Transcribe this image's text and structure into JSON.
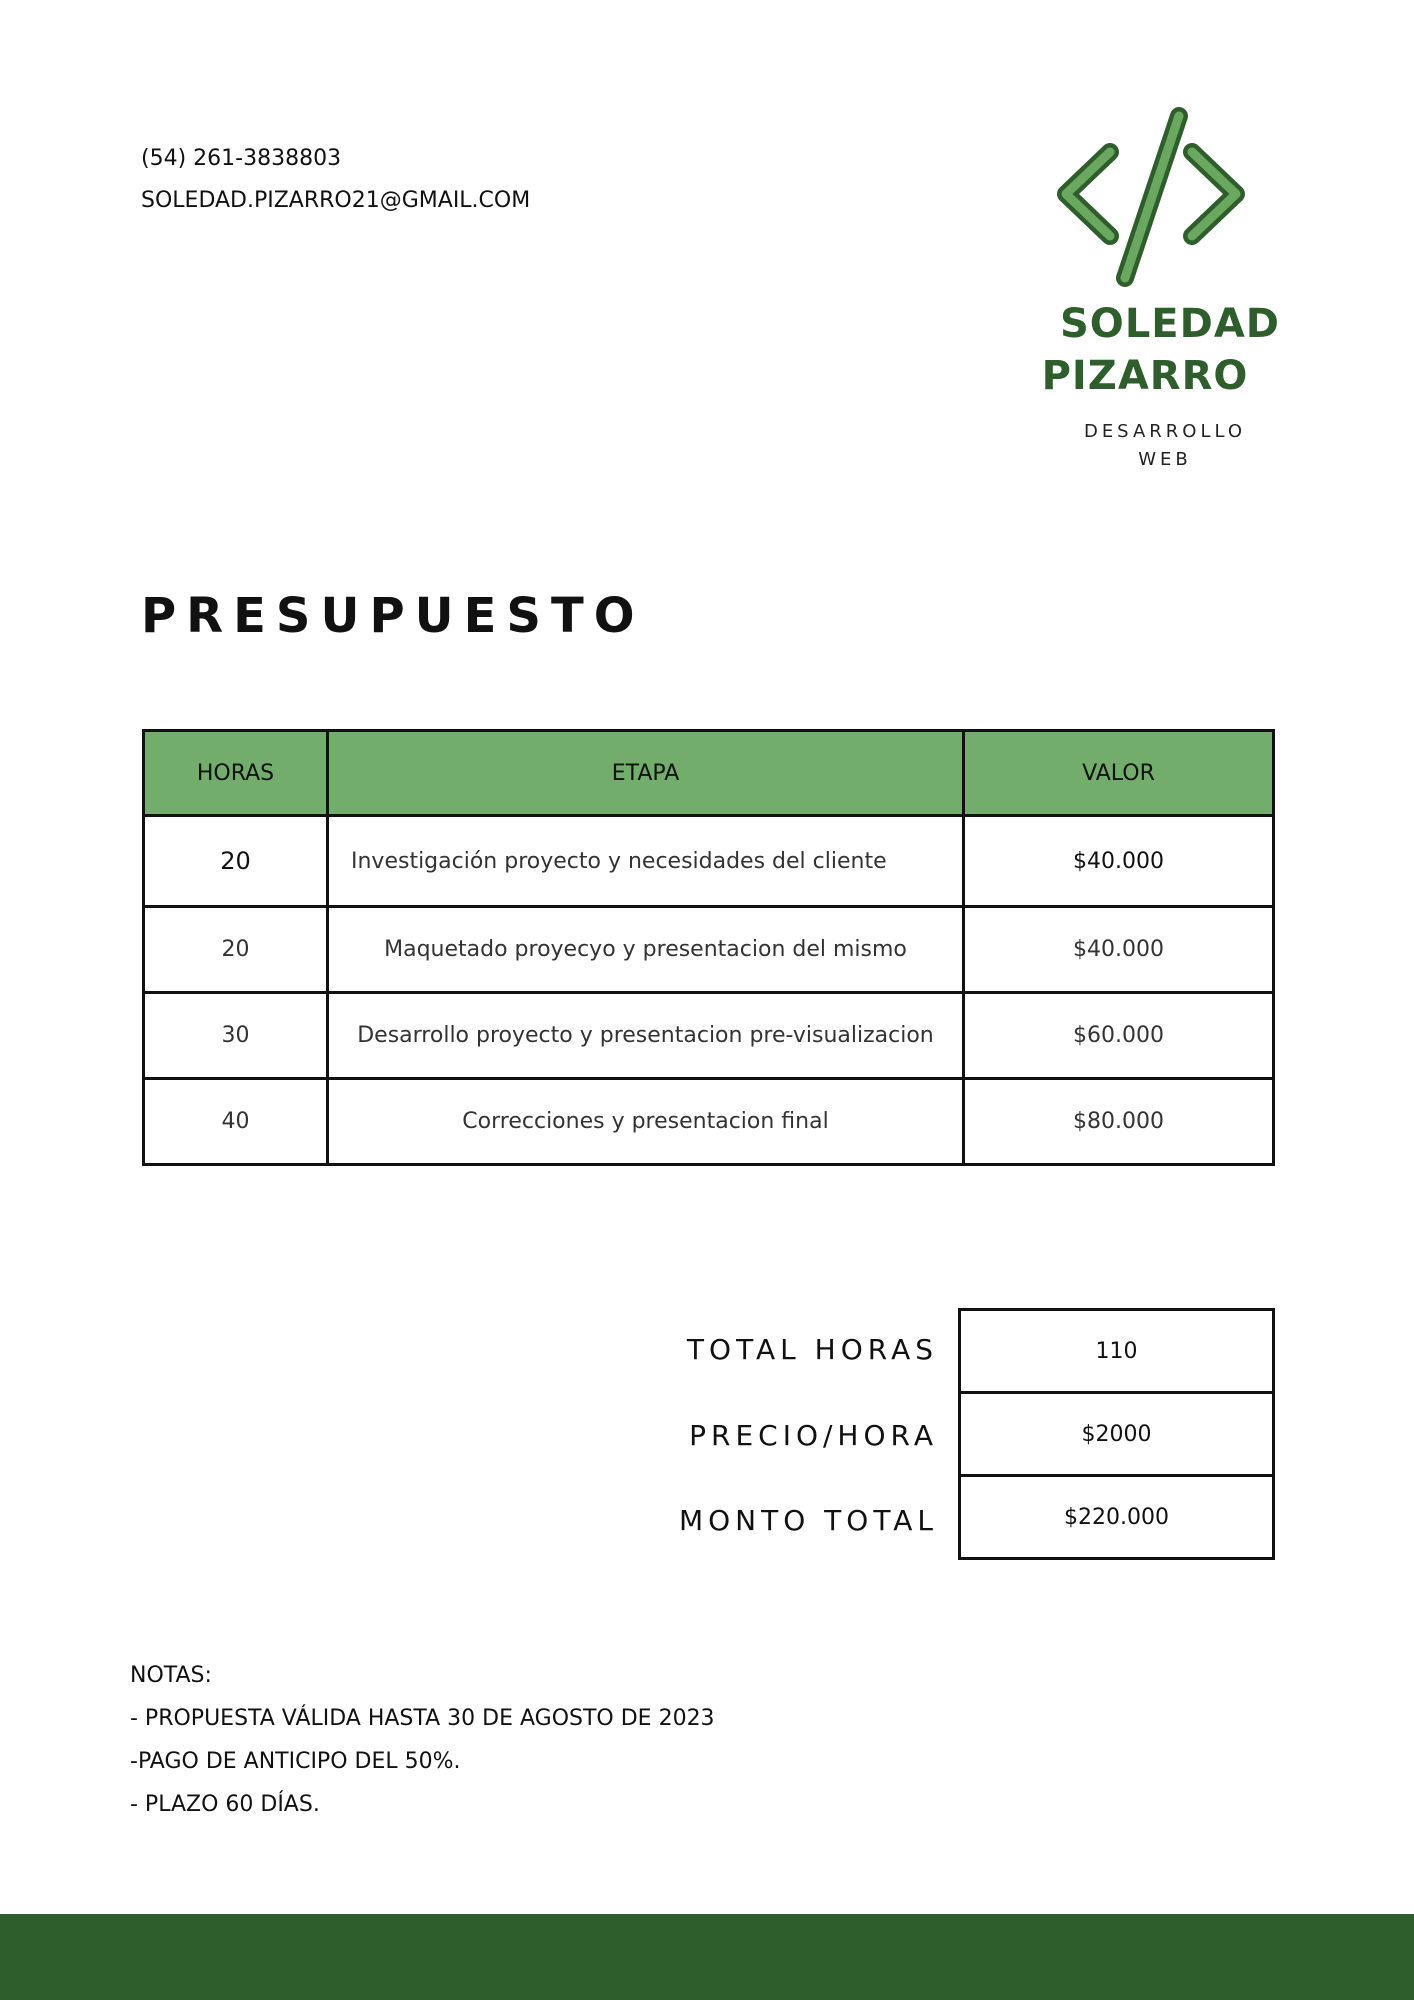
{
  "contact": {
    "phone": "(54) 261-3838803",
    "email": "SOLEDAD.PIZARRO21@GMAIL.COM"
  },
  "logo": {
    "icon": "code-brackets-icon",
    "name_line1": "SOLEDAD",
    "name_line2": "PIZARRO",
    "subtitle_line1": "DESARROLLO",
    "subtitle_line2": "WEB"
  },
  "title": "PRESUPUESTO",
  "table": {
    "headers": [
      "HORAS",
      "ETAPA",
      "VALOR"
    ],
    "rows": [
      {
        "hours": "20",
        "stage": "Investigación proyecto y necesidades del cliente",
        "value": "$40.000"
      },
      {
        "hours": "20",
        "stage": "Maquetado proyecyo y presentacion del mismo",
        "value": "$40.000"
      },
      {
        "hours": "30",
        "stage": "Desarrollo proyecto y presentacion pre-visualizacion",
        "value": "$60.000"
      },
      {
        "hours": "40",
        "stage": "Correcciones y presentacion final",
        "value": "$80.000"
      }
    ]
  },
  "totals": {
    "total_hours_label": "TOTAL HORAS",
    "total_hours_value": "110",
    "price_per_hour_label": "PRECIO/HORA",
    "price_per_hour_value": "$2000",
    "total_amount_label": "MONTO TOTAL",
    "total_amount_value": "$220.000"
  },
  "notes": {
    "heading": "NOTAS:",
    "items": [
      "- PROPUESTA VÁLIDA HASTA 30 DE AGOSTO DE 2023",
      "-PAGO DE ANTICIPO DEL 50%.",
      "- PLAZO 60 DÍAS."
    ]
  },
  "colors": {
    "brand_green": "#2e5e2b",
    "header_green": "#73ad6b",
    "logo_green_fill": "#6aa85f"
  }
}
